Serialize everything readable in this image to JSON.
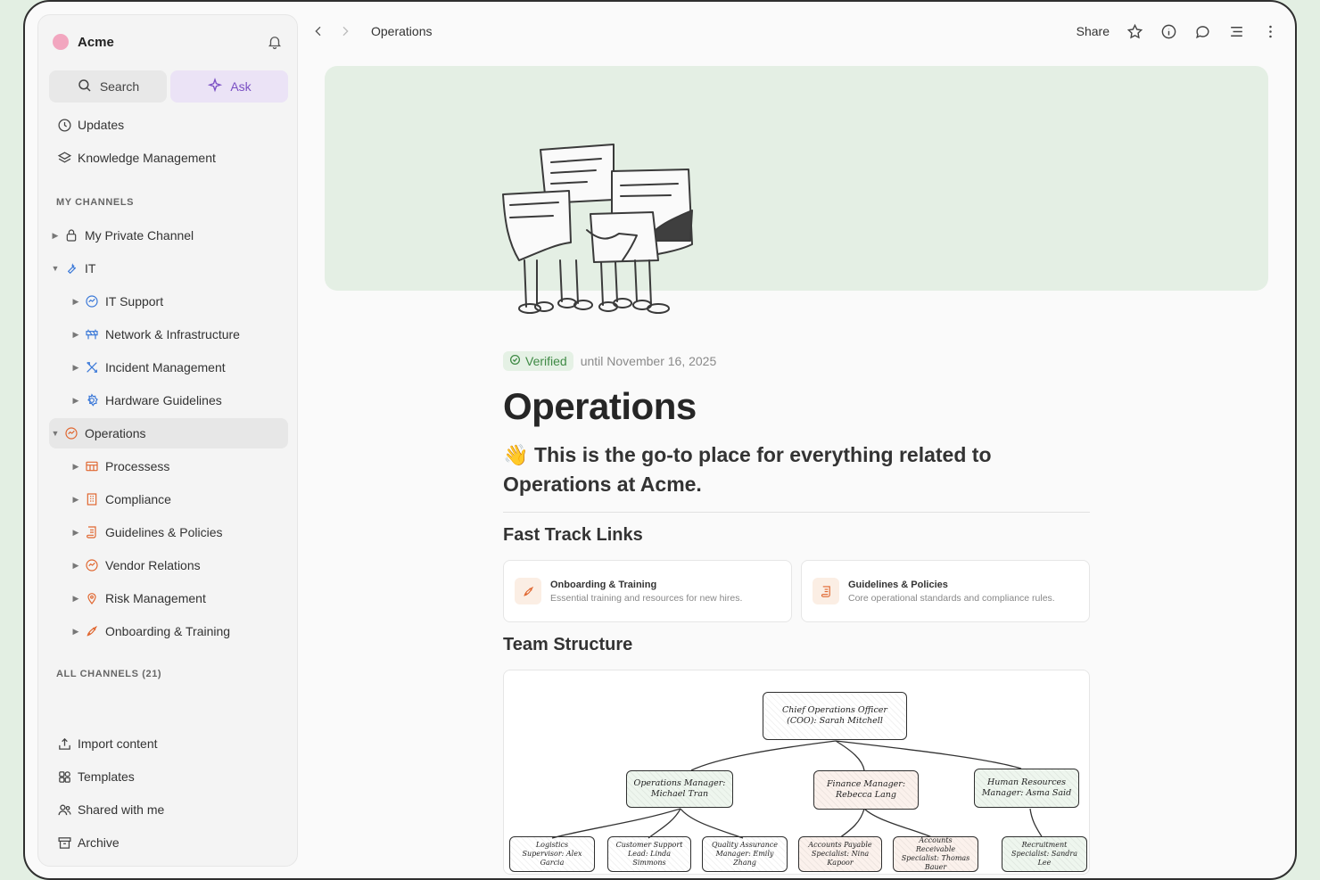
{
  "workspace": {
    "name": "Acme"
  },
  "sidebar": {
    "search_label": "Search",
    "ask_label": "Ask",
    "updates": "Updates",
    "knowledge": "Knowledge Management",
    "my_channels_label": "MY CHANNELS",
    "channels": [
      {
        "label": "My Private Channel"
      },
      {
        "label": "IT"
      },
      {
        "label": "IT Support"
      },
      {
        "label": "Network & Infrastructure"
      },
      {
        "label": "Incident Management"
      },
      {
        "label": "Hardware Guidelines"
      },
      {
        "label": "Operations"
      },
      {
        "label": "Processess"
      },
      {
        "label": "Compliance"
      },
      {
        "label": "Guidelines & Policies"
      },
      {
        "label": "Vendor Relations"
      },
      {
        "label": "Risk Management"
      },
      {
        "label": "Onboarding & Training"
      }
    ],
    "all_channels_label": "ALL CHANNELS (21)",
    "footer": [
      {
        "label": "Import content"
      },
      {
        "label": "Templates"
      },
      {
        "label": "Shared with me"
      },
      {
        "label": "Archive"
      }
    ]
  },
  "topbar": {
    "breadcrumb": "Operations",
    "share": "Share"
  },
  "page": {
    "verified": "Verified",
    "until": "until November 16, 2025",
    "title": "Operations",
    "emoji": "👋",
    "lead": "This is the go-to place for everything related to Operations at Acme.",
    "fast_track_heading": "Fast Track Links",
    "cards": [
      {
        "title": "Onboarding & Training",
        "desc": "Essential training and resources for new hires."
      },
      {
        "title": "Guidelines & Policies",
        "desc": "Core operational standards and compliance rules."
      }
    ],
    "team_heading": "Team Structure",
    "org": {
      "coo": "Chief Operations Officer (COO): Sarah Mitchell",
      "ops_manager": "Operations Manager: Michael Tran",
      "finance_manager": "Finance Manager: Rebecca Lang",
      "hr_manager": "Human Resources Manager: Asma Said",
      "logistics": "Logistics Supervisor: Alex Garcia",
      "support_lead": "Customer Support Lead: Linda Simmons",
      "qa_manager": "Quality Assurance Manager: Emily Zhang",
      "ap_specialist": "Accounts Payable Specialist: Nina Kapoor",
      "ar_specialist": "Accounts Receivable Specialist: Thomas Bauer",
      "recruitment": "Recruitment Specialist: Sandra Lee"
    }
  },
  "colors": {
    "accent_orange": "#e0662f",
    "accent_blue": "#3a78d8",
    "verified_green": "#3f8a45",
    "ask_purple": "#7a4fc4"
  }
}
